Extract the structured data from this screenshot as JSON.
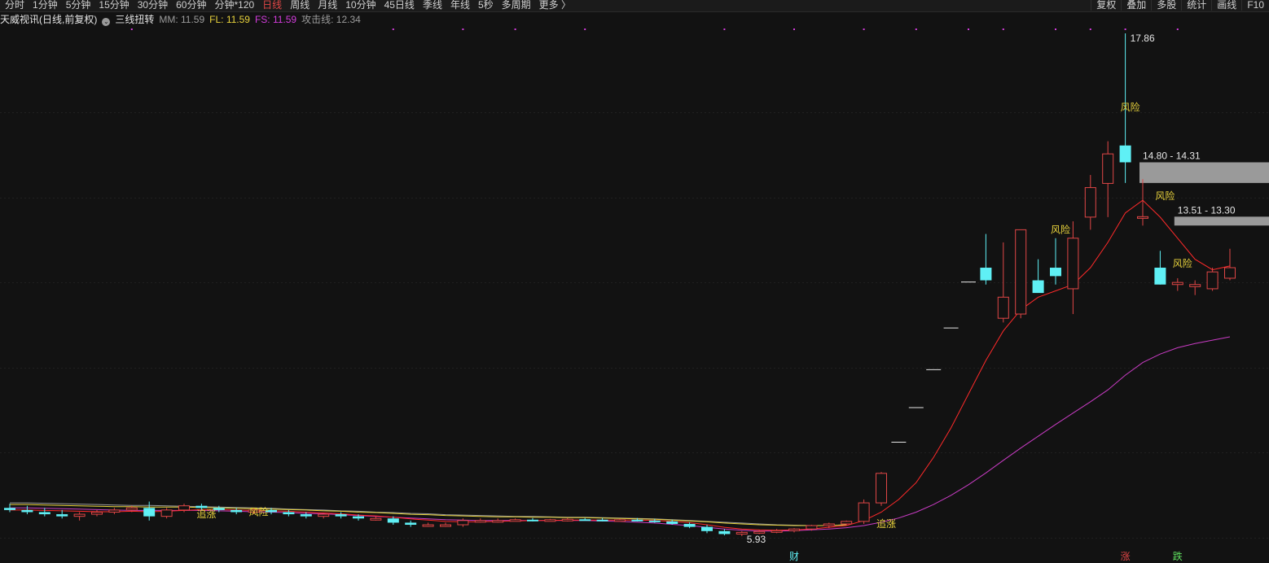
{
  "toolbar": {
    "periods": [
      "分时",
      "1分钟",
      "5分钟",
      "15分钟",
      "30分钟",
      "60分钟",
      "分钟*120",
      "日线",
      "周线",
      "月线",
      "10分钟",
      "45日线",
      "季线",
      "年线",
      "5秒",
      "多周期",
      "更多 〉"
    ],
    "active_period": "日线",
    "tools": [
      "复权",
      "叠加",
      "多股",
      "统计",
      "画线",
      "F10"
    ]
  },
  "info": {
    "stock_title": "天威视讯(日线,前复权)",
    "indicator_name": "三线扭转",
    "mm": "MM: 11.59",
    "fl": "FL: 11.59",
    "fs": "FS: 11.59",
    "attack": "攻击线: 12.34"
  },
  "colors": {
    "up": "#e04646",
    "down": "#5ff0f5",
    "fl_line": "#e8d23c",
    "fs_line": "#d23cdb",
    "mm_line": "#9a9a9a",
    "ma_fast": "#ff2a2a",
    "ma_slow": "#c93cc4",
    "signal_text": "#e8d23c",
    "zone": "#9a9a9a"
  },
  "chart_data": {
    "type": "candlestick",
    "y_low_price": 5.93,
    "y_high_price": 17.86,
    "candles": [
      [
        6.6,
        6.7,
        6.5,
        6.55
      ],
      [
        6.55,
        6.65,
        6.45,
        6.5
      ],
      [
        6.5,
        6.6,
        6.4,
        6.45
      ],
      [
        6.45,
        6.55,
        6.35,
        6.4
      ],
      [
        6.4,
        6.5,
        6.3,
        6.45
      ],
      [
        6.45,
        6.55,
        6.4,
        6.5
      ],
      [
        6.5,
        6.6,
        6.45,
        6.55
      ],
      [
        6.55,
        6.65,
        6.5,
        6.6
      ],
      [
        6.6,
        6.75,
        6.3,
        6.4
      ],
      [
        6.4,
        6.6,
        6.35,
        6.55
      ],
      [
        6.55,
        6.7,
        6.5,
        6.65
      ],
      [
        6.65,
        6.7,
        6.55,
        6.6
      ],
      [
        6.6,
        6.65,
        6.5,
        6.55
      ],
      [
        6.55,
        6.6,
        6.45,
        6.5
      ],
      [
        6.5,
        6.6,
        6.45,
        6.55
      ],
      [
        6.55,
        6.6,
        6.45,
        6.5
      ],
      [
        6.5,
        6.55,
        6.4,
        6.45
      ],
      [
        6.45,
        6.5,
        6.35,
        6.4
      ],
      [
        6.4,
        6.45,
        6.35,
        6.45
      ],
      [
        6.45,
        6.5,
        6.35,
        6.4
      ],
      [
        6.4,
        6.45,
        6.3,
        6.35
      ],
      [
        6.35,
        6.4,
        6.3,
        6.35
      ],
      [
        6.35,
        6.4,
        6.2,
        6.25
      ],
      [
        6.25,
        6.3,
        6.15,
        6.2
      ],
      [
        6.2,
        6.25,
        6.15,
        6.2
      ],
      [
        6.2,
        6.25,
        6.15,
        6.2
      ],
      [
        6.2,
        6.35,
        6.15,
        6.3
      ],
      [
        6.3,
        6.35,
        6.25,
        6.3
      ],
      [
        6.3,
        6.35,
        6.25,
        6.3
      ],
      [
        6.3,
        6.35,
        6.28,
        6.32
      ],
      [
        6.32,
        6.36,
        6.28,
        6.3
      ],
      [
        6.3,
        6.34,
        6.28,
        6.32
      ],
      [
        6.32,
        6.36,
        6.28,
        6.33
      ],
      [
        6.33,
        6.36,
        6.3,
        6.32
      ],
      [
        6.32,
        6.36,
        6.28,
        6.3
      ],
      [
        6.3,
        6.34,
        6.28,
        6.32
      ],
      [
        6.32,
        6.36,
        6.28,
        6.3
      ],
      [
        6.3,
        6.34,
        6.25,
        6.28
      ],
      [
        6.28,
        6.32,
        6.2,
        6.22
      ],
      [
        6.22,
        6.26,
        6.12,
        6.15
      ],
      [
        6.15,
        6.2,
        6.0,
        6.05
      ],
      [
        6.05,
        6.1,
        5.95,
        5.98
      ],
      [
        5.98,
        6.05,
        5.93,
        6.02
      ],
      [
        6.02,
        6.08,
        5.98,
        6.04
      ],
      [
        6.04,
        6.1,
        6.0,
        6.06
      ],
      [
        6.06,
        6.12,
        6.02,
        6.1
      ],
      [
        6.1,
        6.2,
        6.06,
        6.18
      ],
      [
        6.18,
        6.25,
        6.12,
        6.22
      ],
      [
        6.22,
        6.3,
        6.18,
        6.28
      ],
      [
        6.28,
        6.8,
        6.22,
        6.72
      ],
      [
        6.72,
        7.45,
        6.65,
        7.42
      ],
      [
        7.45,
        8.16,
        8.16,
        8.16
      ],
      [
        8.16,
        8.98,
        8.98,
        8.98
      ],
      [
        8.98,
        9.88,
        9.88,
        9.88
      ],
      [
        9.88,
        10.87,
        10.87,
        10.87
      ],
      [
        10.87,
        11.96,
        11.96,
        11.96
      ],
      [
        12.3,
        13.1,
        11.9,
        12.0
      ],
      [
        11.1,
        12.9,
        11.0,
        11.6
      ],
      [
        11.2,
        13.2,
        11.1,
        13.2
      ],
      [
        12.0,
        12.5,
        11.8,
        11.7
      ],
      [
        12.3,
        13.0,
        11.9,
        12.1
      ],
      [
        11.8,
        13.4,
        11.2,
        13.0
      ],
      [
        13.5,
        14.5,
        13.2,
        14.2
      ],
      [
        14.3,
        15.3,
        13.5,
        15.0
      ],
      [
        15.2,
        17.86,
        14.31,
        14.8
      ],
      [
        13.5,
        14.4,
        13.3,
        13.51
      ],
      [
        12.3,
        12.7,
        11.9,
        11.9
      ],
      [
        11.9,
        12.05,
        11.75,
        11.95
      ],
      [
        11.85,
        12.0,
        11.65,
        11.9
      ],
      [
        11.8,
        12.3,
        11.75,
        12.2
      ],
      [
        12.05,
        12.75,
        12.0,
        12.3
      ]
    ],
    "fast_line": [
      6.55,
      6.55,
      6.54,
      6.53,
      6.52,
      6.51,
      6.51,
      6.52,
      6.51,
      6.52,
      6.54,
      6.56,
      6.56,
      6.55,
      6.54,
      6.53,
      6.52,
      6.5,
      6.48,
      6.46,
      6.43,
      6.41,
      6.38,
      6.34,
      6.31,
      6.28,
      6.27,
      6.27,
      6.28,
      6.29,
      6.3,
      6.3,
      6.31,
      6.31,
      6.31,
      6.31,
      6.31,
      6.3,
      6.28,
      6.25,
      6.2,
      6.14,
      6.1,
      6.08,
      6.07,
      6.08,
      6.1,
      6.14,
      6.18,
      6.3,
      6.5,
      6.8,
      7.2,
      7.8,
      8.5,
      9.3,
      10.1,
      10.8,
      11.3,
      11.6,
      11.75,
      11.9,
      12.3,
      12.9,
      13.6,
      13.9,
      13.5,
      13.0,
      12.5,
      12.25,
      12.34
    ],
    "slow_line": [
      6.6,
      6.6,
      6.59,
      6.58,
      6.57,
      6.56,
      6.55,
      6.54,
      6.54,
      6.54,
      6.54,
      6.54,
      6.53,
      6.52,
      6.51,
      6.5,
      6.49,
      6.47,
      6.46,
      6.44,
      6.42,
      6.4,
      6.38,
      6.36,
      6.34,
      6.32,
      6.31,
      6.3,
      6.3,
      6.3,
      6.3,
      6.3,
      6.3,
      6.3,
      6.29,
      6.28,
      6.26,
      6.24,
      6.21,
      6.18,
      6.14,
      6.1,
      6.07,
      6.05,
      6.05,
      6.06,
      6.08,
      6.1,
      6.13,
      6.18,
      6.26,
      6.36,
      6.5,
      6.68,
      6.9,
      7.15,
      7.43,
      7.73,
      8.02,
      8.3,
      8.58,
      8.85,
      9.12,
      9.4,
      9.75,
      10.05,
      10.25,
      10.4,
      10.5,
      10.58,
      10.66
    ],
    "mm_line": [
      6.72,
      6.72,
      6.71,
      6.7,
      6.69,
      6.68,
      6.67,
      6.66,
      6.66,
      6.65,
      6.64,
      6.63,
      6.62,
      6.61,
      6.6,
      6.59,
      6.57,
      6.56,
      6.55,
      6.53,
      6.52,
      6.5,
      6.49,
      6.47,
      6.46,
      6.44,
      6.43,
      6.42,
      6.41,
      6.4,
      6.4,
      6.39,
      6.38,
      6.38,
      6.37,
      6.36,
      6.35,
      6.34,
      6.32,
      6.3,
      6.28,
      6.26,
      6.24,
      6.22,
      6.2,
      6.19,
      6.18,
      6.18,
      6.2
    ],
    "fl_line": [
      6.68,
      6.68,
      6.67,
      6.66,
      6.65,
      6.64,
      6.63,
      6.63,
      6.62,
      6.62,
      6.62,
      6.61,
      6.6,
      6.59,
      6.58,
      6.57,
      6.56,
      6.55,
      6.53,
      6.52,
      6.5,
      6.49,
      6.47,
      6.45,
      6.44,
      6.42,
      6.41,
      6.4,
      6.39,
      6.39,
      6.38,
      6.38,
      6.37,
      6.37,
      6.36,
      6.35,
      6.34,
      6.33,
      6.31,
      6.29,
      6.27,
      6.24,
      6.22,
      6.2,
      6.19,
      6.18,
      6.18,
      6.18,
      6.2
    ],
    "labels": [
      {
        "index": 11,
        "text": "追涨",
        "price": 6.45
      },
      {
        "index": 14,
        "text": "风险",
        "price": 6.5
      },
      {
        "index": 50,
        "text": "追涨",
        "price": 6.22
      },
      {
        "index": 60,
        "text": "风险",
        "price": 13.2
      },
      {
        "index": 64,
        "text": "风险",
        "price": 16.1
      },
      {
        "index": 66,
        "text": "风险",
        "price": 14.0
      },
      {
        "index": 67,
        "text": "风险",
        "price": 12.4
      }
    ],
    "price_marks": [
      {
        "index": 64,
        "text": "17.86",
        "price": 17.86
      },
      {
        "index": 42,
        "text": "5.93",
        "price": 5.93
      }
    ],
    "zones": [
      {
        "from_index": 65,
        "text": "14.80 - 14.31",
        "top": 14.8,
        "bottom": 14.31
      },
      {
        "from_index": 67,
        "text": "13.51 - 13.30",
        "top": 13.51,
        "bottom": 13.3
      }
    ],
    "top_dots": [
      7,
      22,
      26,
      29,
      33,
      41,
      45,
      49,
      52,
      55,
      57,
      60,
      62,
      64,
      67
    ],
    "event_markers": [
      {
        "index": 45,
        "text": "财",
        "color": "#5ff0f5"
      },
      {
        "index": 64,
        "text": "涨",
        "color": "#e04646"
      },
      {
        "index": 67,
        "text": "跌",
        "color": "#5fe05f"
      }
    ]
  }
}
